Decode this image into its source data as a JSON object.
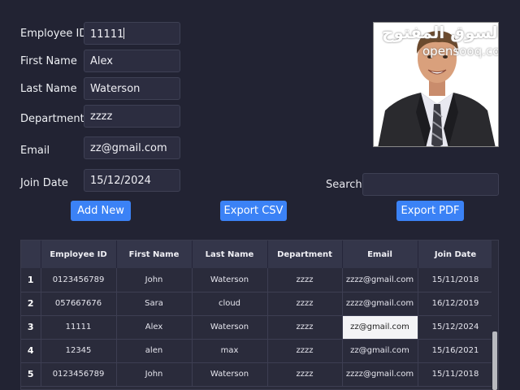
{
  "form": {
    "employee_id": {
      "label": "Employee ID",
      "value": "11111"
    },
    "first_name": {
      "label": "First Name",
      "value": "Alex"
    },
    "last_name": {
      "label": "Last Name",
      "value": "Waterson"
    },
    "department": {
      "label": "Department",
      "value": "zzzz"
    },
    "email": {
      "label": "Email",
      "value": "zz@gmail.com"
    },
    "join_date": {
      "label": "Join Date",
      "value": "15/12/2024"
    }
  },
  "buttons": {
    "add_new": "Add New",
    "export_csv": "Export CSV",
    "export_pdf": "Export PDF"
  },
  "search": {
    "label": "Search",
    "value": ""
  },
  "photo": {
    "watermark_arabic": "السوق المفتوح",
    "watermark_latin": "opensooq.com"
  },
  "table": {
    "columns": [
      "Employee ID",
      "First Name",
      "Last Name",
      "Department",
      "Email",
      "Join Date"
    ],
    "rows": [
      {
        "num": "1",
        "cells": [
          "0123456789",
          "John",
          "Waterson",
          "zzzz",
          "zzzz@gmail.com",
          "15/11/2018"
        ]
      },
      {
        "num": "2",
        "cells": [
          "057667676",
          "Sara",
          "cloud",
          "zzzz",
          "zzzz@gmail.com",
          "16/12/2019"
        ]
      },
      {
        "num": "3",
        "cells": [
          "11111",
          "Alex",
          "Waterson",
          "zzzz",
          "zz@gmail.com",
          "15/12/2024"
        ]
      },
      {
        "num": "4",
        "cells": [
          "12345",
          "alen",
          "max",
          "zzzz",
          "zz@gmail.com",
          "15/16/2021"
        ]
      },
      {
        "num": "5",
        "cells": [
          "0123456789",
          "John",
          "Waterson",
          "zzzz",
          "zzzz@gmail.com",
          "15/11/2018"
        ]
      }
    ],
    "selected_cell": {
      "row": 2,
      "col": 4
    }
  },
  "colors": {
    "background": "#222333",
    "accent": "#3b82f6",
    "input_bg": "#2c2d40"
  }
}
